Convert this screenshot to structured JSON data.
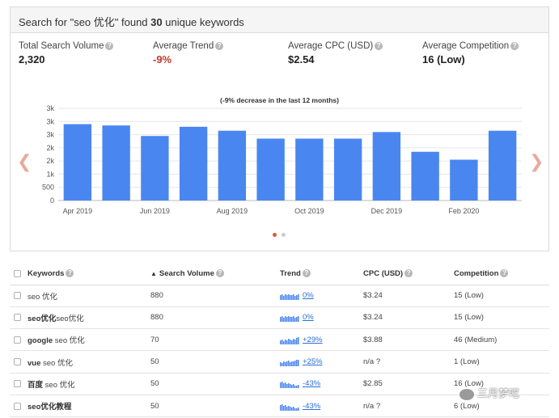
{
  "header": {
    "prefix": "Search for \"seo 优化\" found ",
    "count": "30",
    "suffix": " unique keywords"
  },
  "stats": [
    {
      "label": "Total Search Volume",
      "value": "2,320"
    },
    {
      "label": "Average Trend",
      "value": "-9%"
    },
    {
      "label": "Average CPC (USD)",
      "value": "$2.54"
    },
    {
      "label": "Average Competition",
      "value": "16 (Low)"
    }
  ],
  "colors": {
    "bar": "#4a86f0",
    "negative": "#c0392b",
    "link": "#2a6ed8",
    "arrow": "#e8a99a",
    "dot_active": "#e5533d",
    "dot_inactive": "#cccccc"
  },
  "chart_data": {
    "type": "bar",
    "title": "(-9% decrease in the last 12 months)",
    "x_tick_labels": [
      "Apr 2019",
      "Jun 2019",
      "Aug 2019",
      "Oct 2019",
      "Dec 2019",
      "Feb 2020"
    ],
    "y_tick_labels": [
      "0",
      "500",
      "1k",
      "2k",
      "2k",
      "3k",
      "3k",
      "3k"
    ],
    "y_ticks": [
      0,
      500,
      1000,
      1500,
      2000,
      2500,
      3000,
      3500
    ],
    "ylim": [
      0,
      3500
    ],
    "categories": [
      "Apr 2019",
      "May 2019",
      "Jun 2019",
      "Jul 2019",
      "Aug 2019",
      "Sep 2019",
      "Oct 2019",
      "Nov 2019",
      "Dec 2019",
      "Jan 2020",
      "Feb 2020",
      "Mar 2020"
    ],
    "values": [
      2900,
      2850,
      2450,
      2800,
      2650,
      2350,
      2350,
      2350,
      2600,
      1850,
      1550,
      2650
    ],
    "grid": true,
    "legend": "none"
  },
  "table": {
    "headers": {
      "keywords": "Keywords",
      "volume": "Search Volume",
      "trend": "Trend",
      "cpc": "CPC (USD)",
      "competition": "Competition"
    },
    "rows": [
      {
        "keyword": "seo 优化",
        "bold": "",
        "volume": "880",
        "trend": "0%",
        "cpc": "$3.24",
        "competition": "15 (Low)"
      },
      {
        "keyword": "seo优化",
        "bold": "seo优化",
        "volume": "880",
        "trend": "0%",
        "cpc": "$3.24",
        "competition": "15 (Low)"
      },
      {
        "keyword": " seo 优化",
        "bold": "google",
        "volume": "70",
        "trend": "+29%",
        "cpc": "$3.88",
        "competition": "46 (Medium)"
      },
      {
        "keyword": " seo 优化",
        "bold": "vue",
        "volume": "50",
        "trend": "+25%",
        "cpc": "n/a ?",
        "competition": "1 (Low)"
      },
      {
        "keyword": " seo 优化",
        "bold": "百度",
        "volume": "50",
        "trend": "-43%",
        "cpc": "$2.85",
        "competition": "16 (Low)"
      },
      {
        "keyword": "",
        "bold": "seo优化教程",
        "volume": "50",
        "trend": "-43%",
        "cpc": "n/a ?",
        "competition": "6 (Low)"
      }
    ]
  },
  "watermark": "三月梦呓"
}
